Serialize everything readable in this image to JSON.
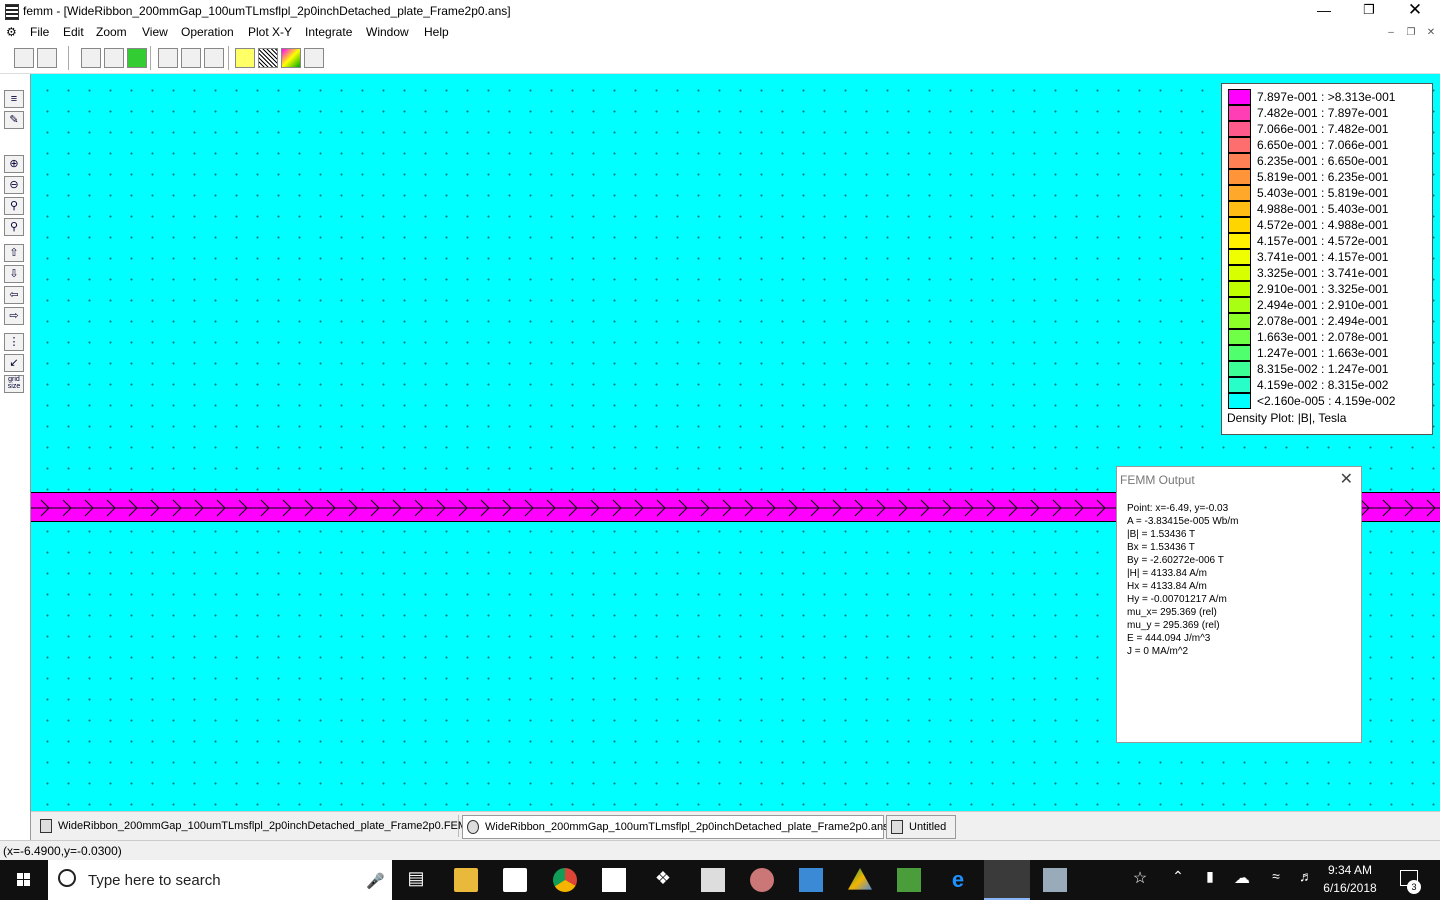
{
  "window": {
    "title": "femm - [WideRibbon_200mmGap_100umTLmsflpl_2p0inchDetached_plate_Frame2p0.ans]",
    "minimize_icon": "minimize-icon",
    "maximize_icon": "restore-icon",
    "close_icon": "close-icon"
  },
  "menu": {
    "items": [
      "File",
      "Edit",
      "Zoom",
      "View",
      "Operation",
      "Plot X-Y",
      "Integrate",
      "Window",
      "Help"
    ]
  },
  "legend": {
    "rows": [
      {
        "label": "7.897e-001 : >8.313e-001",
        "color": "#ff00ff"
      },
      {
        "label": "7.482e-001 : 7.897e-001",
        "color": "#ff3db4"
      },
      {
        "label": "7.066e-001 : 7.482e-001",
        "color": "#ff5a8c"
      },
      {
        "label": "6.650e-001 : 7.066e-001",
        "color": "#ff6e6e"
      },
      {
        "label": "6.235e-001 : 6.650e-001",
        "color": "#ff8055"
      },
      {
        "label": "5.819e-001 : 6.235e-001",
        "color": "#ff9438"
      },
      {
        "label": "5.403e-001 : 5.819e-001",
        "color": "#ffa82a"
      },
      {
        "label": "4.988e-001 : 5.403e-001",
        "color": "#ffbc14"
      },
      {
        "label": "4.572e-001 : 4.988e-001",
        "color": "#ffd500"
      },
      {
        "label": "4.157e-001 : 4.572e-001",
        "color": "#fff000"
      },
      {
        "label": "3.741e-001 : 4.157e-001",
        "color": "#f0ff00"
      },
      {
        "label": "3.325e-001 : 3.741e-001",
        "color": "#d8ff00"
      },
      {
        "label": "2.910e-001 : 3.325e-001",
        "color": "#c0ff00"
      },
      {
        "label": "2.494e-001 : 2.910e-001",
        "color": "#a8ff14"
      },
      {
        "label": "2.078e-001 : 2.494e-001",
        "color": "#8cff28"
      },
      {
        "label": "1.663e-001 : 2.078e-001",
        "color": "#6eff46"
      },
      {
        "label": "1.247e-001 : 1.663e-001",
        "color": "#50ff6e"
      },
      {
        "label": "8.315e-002 : 1.247e-001",
        "color": "#3cff96"
      },
      {
        "label": "4.159e-002 : 8.315e-002",
        "color": "#28ffc8"
      },
      {
        "label": "<2.160e-005 : 4.159e-002",
        "color": "#00ffff"
      }
    ],
    "caption": "Density Plot: |B|, Tesla"
  },
  "output": {
    "title": "FEMM Output",
    "lines": [
      "Point: x=-6.49, y=-0.03",
      "A   = -3.83415e-005 Wb/m",
      "|B| = 1.53436 T",
      "Bx  = 1.53436 T",
      "By  = -2.60272e-006 T",
      "|H| = 4133.84 A/m",
      "Hx  = 4133.84 A/m",
      "Hy  = -0.00701217 A/m",
      "mu_x= 295.369 (rel)",
      "mu_y = 295.369 (rel)",
      "E   = 444.094 J/m^3",
      "J   = 0 MA/m^2"
    ]
  },
  "tabs": [
    {
      "label": "WideRibbon_200mmGap_100umTLmsflpl_2p0inchDetached_plate_Frame2p0.FEM",
      "icon": "femm-doc-icon"
    },
    {
      "label": "WideRibbon_200mmGap_100umTLmsflpl_2p0inchDetached_plate_Frame2p0.ans",
      "icon": "postprocessor-icon"
    },
    {
      "label": "Untitled",
      "icon": "xy-plot-icon"
    }
  ],
  "status": {
    "text": "(x=-6.4900,y=-0.0300)"
  },
  "taskbar": {
    "search_placeholder": "Type here to search",
    "time": "9:34 AM",
    "date": "6/16/2018",
    "notification_count": "3"
  },
  "colors": {
    "canvas": "#00ffff",
    "strip": "#ff00ff"
  }
}
